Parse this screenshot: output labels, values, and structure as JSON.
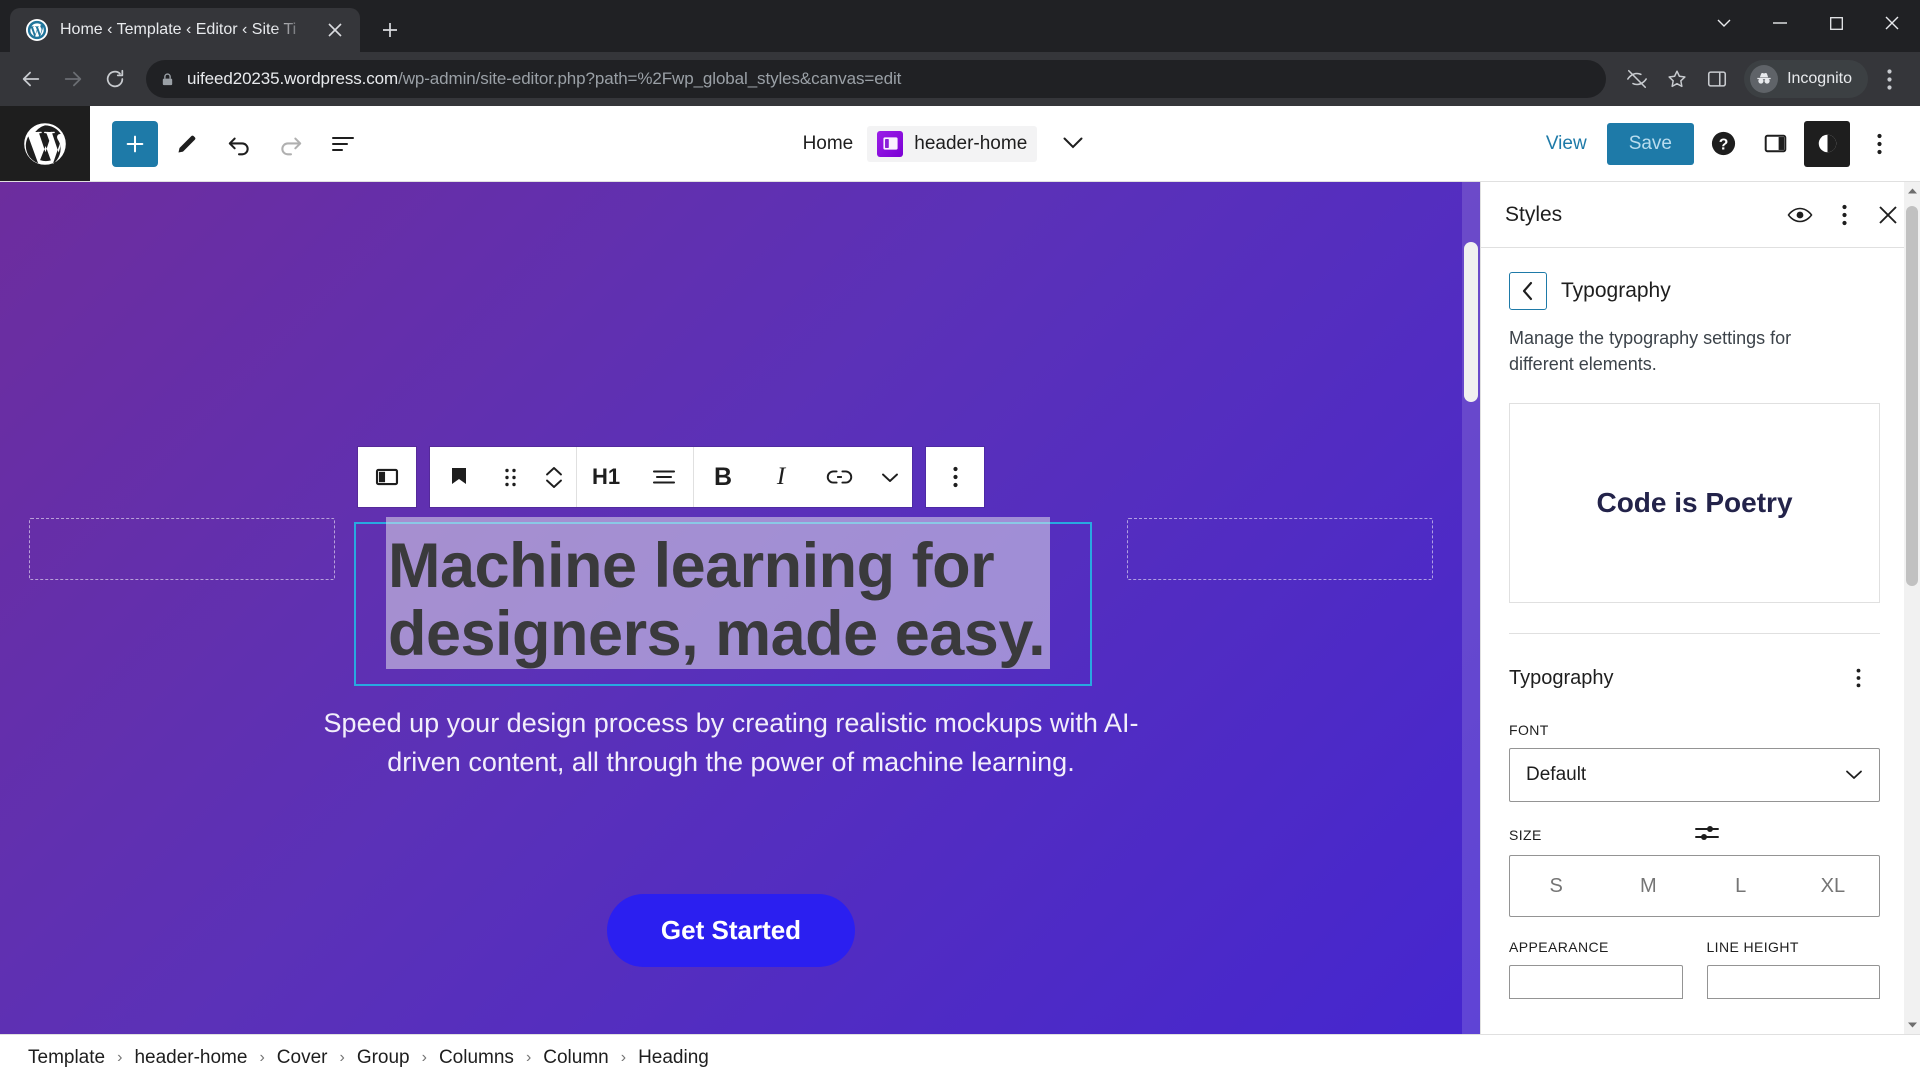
{
  "browser": {
    "tab": {
      "title": "Home ‹ Template ‹ Editor ‹ Site Ti",
      "favicon_name": "wordpress-favicon",
      "close_label": "✕"
    },
    "new_tab_label": "+",
    "window_controls": {
      "minimize": "—",
      "maximize": "▢",
      "close": "✕",
      "chevron": "⌄"
    },
    "address": {
      "domain": "uifeed20235.wordpress.com",
      "path": "/wp-admin/site-editor.php?path=%2Fwp_global_styles&canvas=edit",
      "lock_icon": "lock-icon"
    },
    "profile": {
      "label": "Incognito"
    }
  },
  "editor_header": {
    "logo_name": "wordpress-logo",
    "tools": [
      {
        "name": "add-block-button",
        "glyph": "+"
      },
      {
        "name": "edit-tool-button",
        "glyph": "pencil"
      },
      {
        "name": "undo-button",
        "glyph": "undo"
      },
      {
        "name": "redo-button",
        "glyph": "redo"
      },
      {
        "name": "list-view-button",
        "glyph": "list-view"
      }
    ],
    "document_home": "Home",
    "template_name": "header-home",
    "dropdown_glyph": "⌄",
    "view_label": "View",
    "save_label": "Save",
    "help_label": "?",
    "sidebar_toggle_name": "settings-sidebar-toggle",
    "styles_toggle_name": "styles-toggle",
    "options_name": "more-options"
  },
  "block_toolbar": {
    "parent_block": "column-block-icon",
    "items": [
      {
        "name": "heading-block-icon",
        "glyph": "heading"
      },
      {
        "name": "drag-handle-icon",
        "glyph": "drag"
      },
      {
        "name": "move-up-down-icon",
        "glyph": "movers"
      },
      {
        "name": "heading-level-button",
        "glyph": "H1"
      },
      {
        "name": "align-text-button",
        "glyph": "align"
      },
      {
        "name": "bold-button",
        "glyph": "B"
      },
      {
        "name": "italic-button",
        "glyph": "I"
      },
      {
        "name": "link-button",
        "glyph": "link"
      },
      {
        "name": "more-rich-text-button",
        "glyph": "⌄"
      },
      {
        "name": "block-options-button",
        "glyph": "⋮"
      }
    ]
  },
  "canvas": {
    "heading": "Machine learning for designers, made easy.",
    "paragraph": "Speed up your design process by creating realistic mockups with AI-driven content, all through the power of machine learning.",
    "cta_label": "Get Started",
    "cta_color": "#2b1ff0",
    "background_from": "#6d2d9e",
    "background_to": "#4526cf",
    "selection_border_color": "#29a8e0"
  },
  "breadcrumb": {
    "separator": "›",
    "items": [
      "Template",
      "header-home",
      "Cover",
      "Group",
      "Columns",
      "Column",
      "Heading"
    ]
  },
  "styles_panel": {
    "title": "Styles",
    "header_icons": [
      {
        "name": "style-book-icon",
        "glyph": "eye"
      },
      {
        "name": "styles-more-options",
        "glyph": "⋮"
      },
      {
        "name": "close-styles-panel",
        "glyph": "✕"
      }
    ],
    "back_glyph": "‹",
    "screen_title": "Typography",
    "description": "Manage the typography settings for different elements.",
    "preview_text": "Code is Poetry",
    "preview_color": "#23234a",
    "section": {
      "title": "Typography",
      "more_glyph": "⋮",
      "font": {
        "label": "Font",
        "value": "Default",
        "chevron": "⌄"
      },
      "size": {
        "label": "Size",
        "options": [
          "S",
          "M",
          "L",
          "XL"
        ],
        "selected": "",
        "toggle_name": "set-custom-size-icon"
      },
      "appearance_label": "Appearance",
      "line_height_label": "Line height"
    }
  }
}
